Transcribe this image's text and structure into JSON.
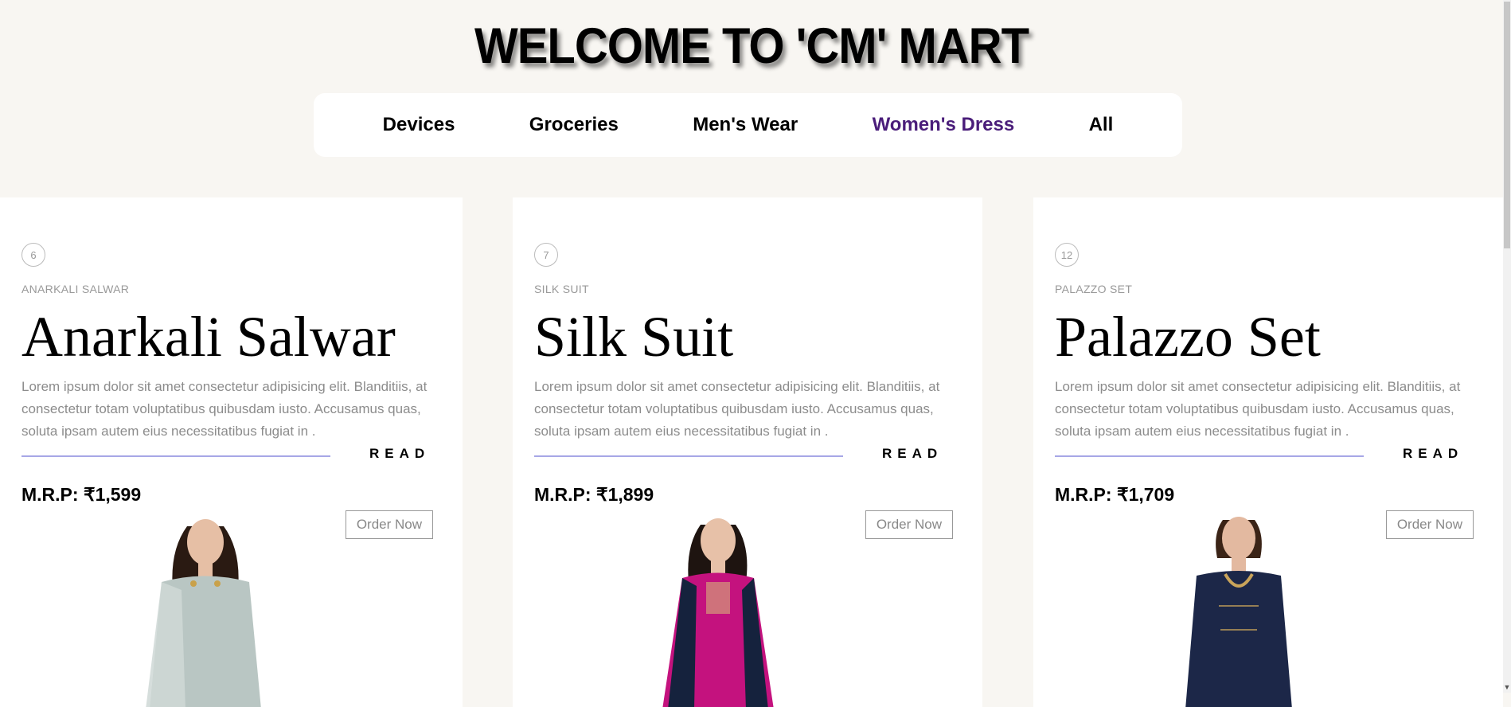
{
  "header": {
    "title": "WELCOME TO 'CM' MART"
  },
  "nav": {
    "items": [
      {
        "label": "Devices",
        "active": false
      },
      {
        "label": "Groceries",
        "active": false
      },
      {
        "label": "Men's Wear",
        "active": false
      },
      {
        "label": "Women's Dress",
        "active": true
      },
      {
        "label": "All",
        "active": false
      }
    ]
  },
  "cards": [
    {
      "number": "6",
      "kicker": "ANARKALI SALWAR",
      "name": "Anarkali Salwar",
      "description": "Lorem ipsum dolor sit amet consectetur adipisicing elit. Blanditiis, at consectetur totam voluptatibus quibusdam iusto. Accusamus quas, soluta ipsam autem eius necessitatibus fugiat in .",
      "read_label": "READ",
      "price": "M.R.P: ₹1,599",
      "order_label": "Order Now",
      "dress_color": "#b9c6c3"
    },
    {
      "number": "7",
      "kicker": "SILK SUIT",
      "name": "Silk Suit",
      "description": "Lorem ipsum dolor sit amet consectetur adipisicing elit. Blanditiis, at consectetur totam voluptatibus quibusdam iusto. Accusamus quas, soluta ipsam autem eius necessitatibus fugiat in .",
      "read_label": "READ",
      "price": "M.R.P: ₹1,899",
      "order_label": "Order Now",
      "dress_color": "#c4127e"
    },
    {
      "number": "12",
      "kicker": "PALAZZO SET",
      "name": "Palazzo Set",
      "description": "Lorem ipsum dolor sit amet consectetur adipisicing elit. Blanditiis, at consectetur totam voluptatibus quibusdam iusto. Accusamus quas, soluta ipsam autem eius necessitatibus fugiat in .",
      "read_label": "READ",
      "price": "M.R.P: ₹1,709",
      "order_label": "Order Now",
      "dress_color": "#1c2748"
    }
  ],
  "colors": {
    "active_nav": "#4a1d7a",
    "accent_line": "#a7a7e6",
    "page_bg": "#f8f6f2"
  }
}
